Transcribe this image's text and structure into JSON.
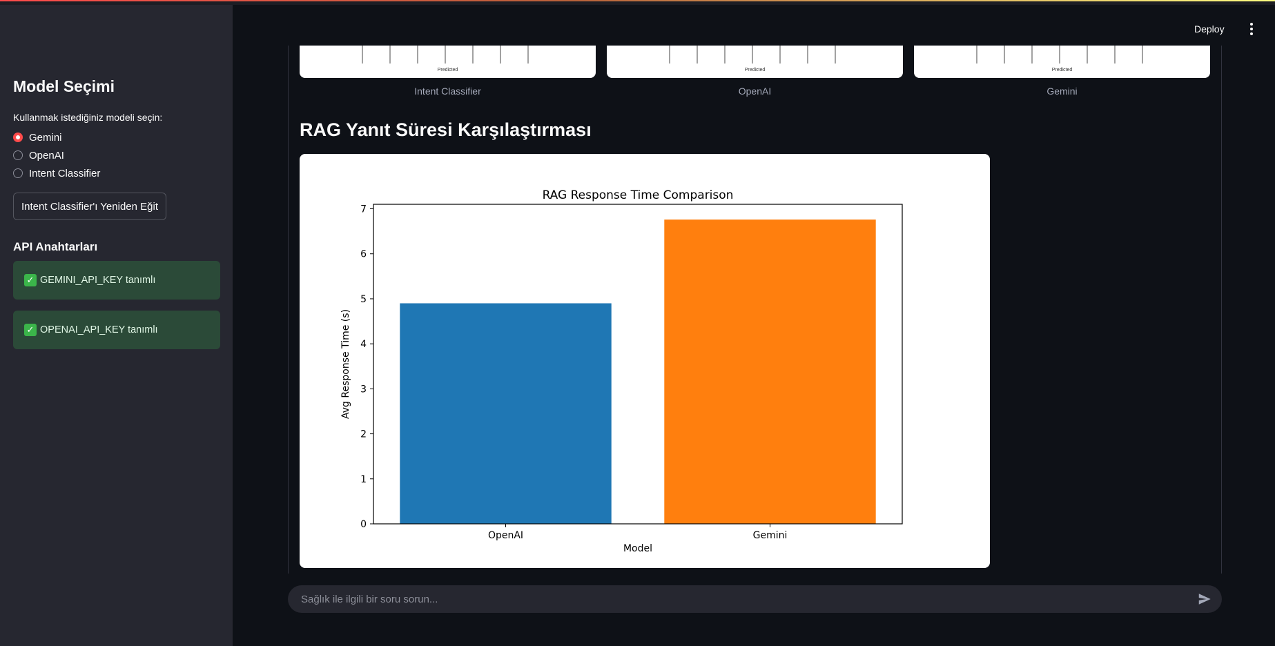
{
  "header": {
    "deploy_label": "Deploy",
    "menu_icon": "more-vertical-icon"
  },
  "sidebar": {
    "title": "Model Seçimi",
    "radio_label": "Kullanmak istediğiniz modeli seçin:",
    "options": [
      {
        "label": "Gemini",
        "selected": true
      },
      {
        "label": "OpenAI",
        "selected": false
      },
      {
        "label": "Intent Classifier",
        "selected": false
      }
    ],
    "retrain_button": "Intent Classifier'ı Yeniden Eğit",
    "api_heading": "API Anahtarları",
    "status_messages": [
      {
        "icon": "check-mark-icon",
        "text": "GEMINI_API_KEY tanımlı"
      },
      {
        "icon": "check-mark-icon",
        "text": "OPENAI_API_KEY tanımlı"
      }
    ]
  },
  "confusion_matrices": {
    "axis_label": "Predicted",
    "captions": [
      "Intent Classifier",
      "OpenAI",
      "Gemini"
    ]
  },
  "section": {
    "title": "RAG Yanıt Süresi Karşılaştırması"
  },
  "chart_data": {
    "type": "bar",
    "title": "RAG Response Time Comparison",
    "xlabel": "Model",
    "ylabel": "Avg Response Time (s)",
    "categories": [
      "OpenAI",
      "Gemini"
    ],
    "values": [
      4.9,
      6.76
    ],
    "colors": [
      "#1f77b4",
      "#ff7f0e"
    ],
    "ylim": [
      0,
      7.1
    ],
    "yticks": [
      0,
      1,
      2,
      3,
      4,
      5,
      6,
      7
    ],
    "grid": false
  },
  "chat": {
    "placeholder": "Sağlık ile ilgili bir soru sorun...",
    "send_icon": "send-icon"
  },
  "colors": {
    "accent": "#ff4b4b",
    "background": "#0e1117",
    "sidebar": "#262730",
    "success_bg": "#2b4a38"
  }
}
